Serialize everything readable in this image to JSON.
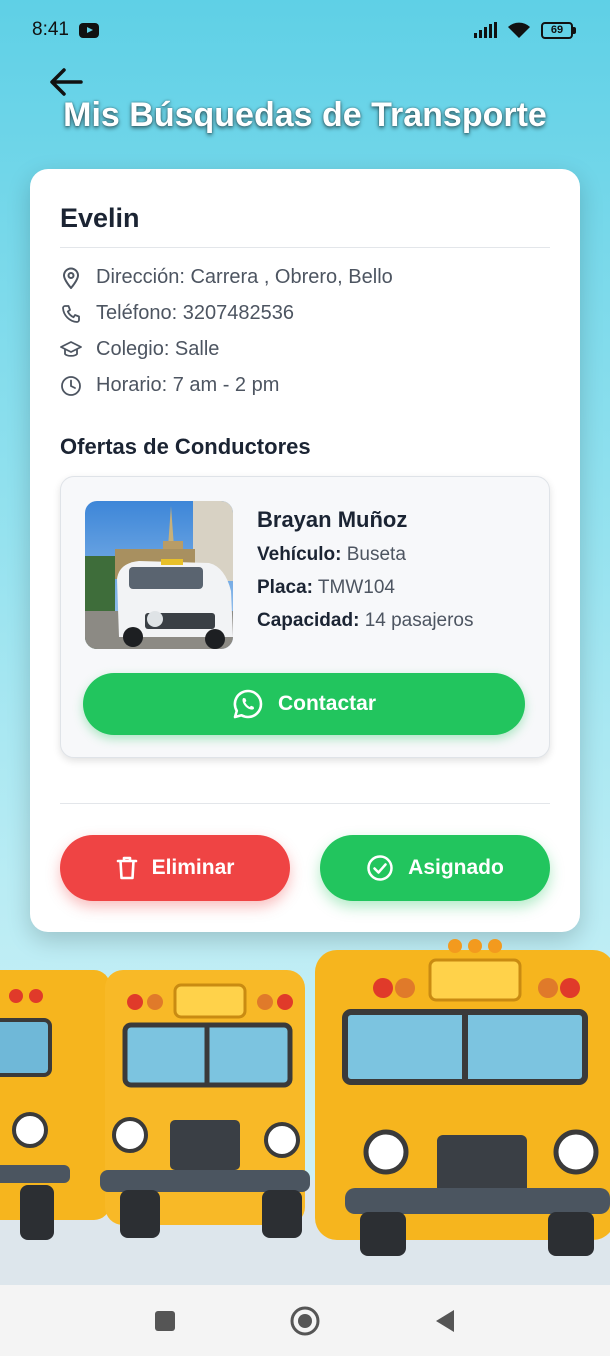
{
  "status_bar": {
    "time": "8:41",
    "battery": "69",
    "icons": [
      "youtube-icon",
      "signal-icon",
      "wifi-icon",
      "battery-icon"
    ]
  },
  "header": {
    "back_icon": "arrow-left-icon",
    "title": "Mis Búsquedas de Transporte"
  },
  "search": {
    "student_name": "Evelin",
    "address": "Dirección: Carrera , Obrero, Bello",
    "phone": "Teléfono: 3207482536",
    "school": "Colegio: Salle",
    "schedule": "Horario: 7 am - 2 pm"
  },
  "offers_section": {
    "title": "Ofertas de Conductores",
    "offers": [
      {
        "driver_name": "Brayan Muñoz",
        "vehicle_label": "Vehículo:",
        "vehicle_value": "Buseta",
        "plate_label": "Placa:",
        "plate_value": "TMW104",
        "capacity_label": "Capacidad:",
        "capacity_value": "14 pasajeros",
        "contact_label": "Contactar"
      }
    ]
  },
  "actions": {
    "delete_label": "Eliminar",
    "assigned_label": "Asignado"
  },
  "colors": {
    "accent_green": "#22c55e",
    "danger_red": "#ef4444",
    "sky": "#5fd0e6",
    "bus_yellow": "#f6b51e"
  },
  "nav_bar": [
    "recents-square-icon",
    "home-circle-icon",
    "back-triangle-icon"
  ]
}
